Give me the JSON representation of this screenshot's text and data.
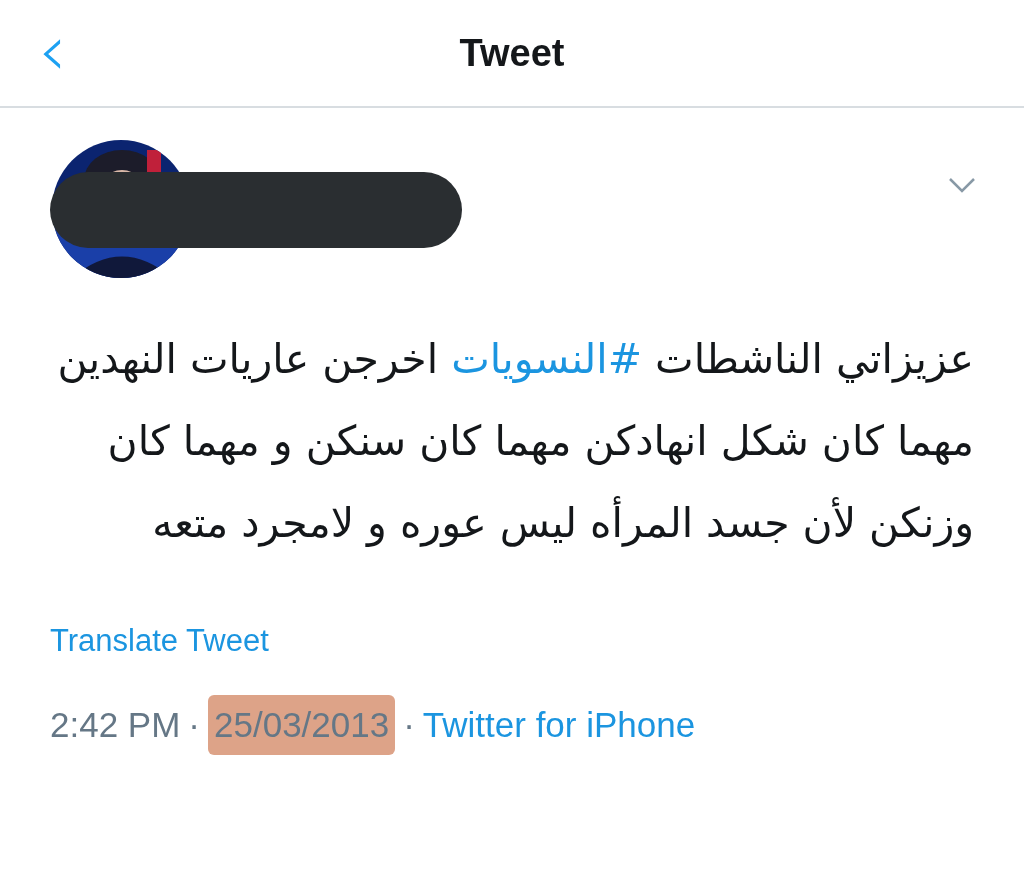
{
  "header": {
    "back": "‹",
    "title": "Tweet"
  },
  "author": {
    "name_redacted": true
  },
  "tweet": {
    "text_before": "عزيزاتي الناشطات ",
    "hashtag": "#النسويات",
    "text_after": " اخرجن عاريات النهدين مهما كان شكل انهادكن مهما كان سنكن و مهما كان وزنكن لأن جسد المرأه ليس عوره و لامجرد متعه"
  },
  "translate": "Translate Tweet",
  "meta": {
    "time": "2:42 PM",
    "separator_1": "·",
    "date": "25/03/2013",
    "date_highlighted": true,
    "separator_2": "·",
    "source": "Twitter for iPhone"
  }
}
